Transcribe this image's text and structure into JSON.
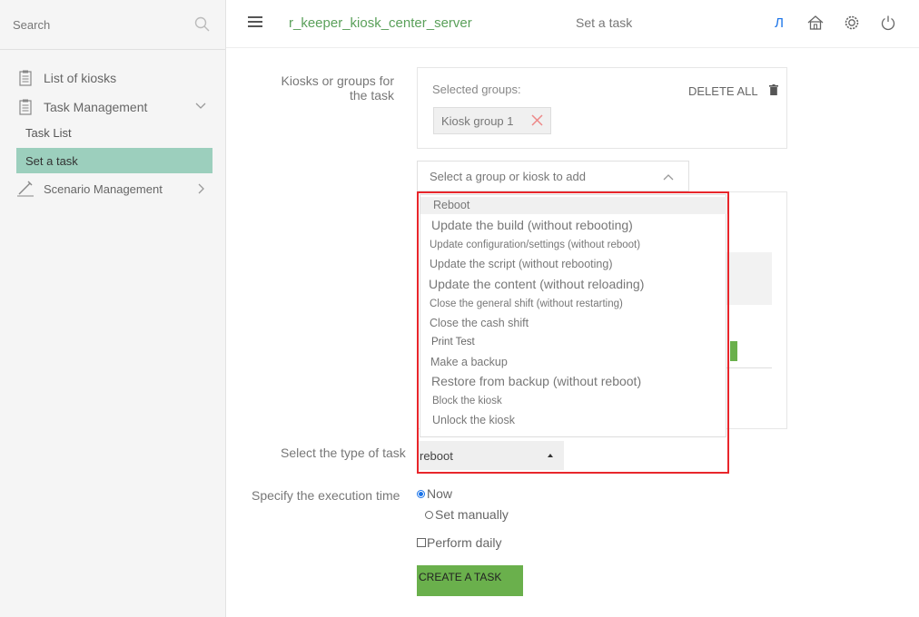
{
  "sidebar": {
    "search_placeholder": "Search",
    "items": [
      {
        "label": "List of kiosks"
      },
      {
        "label": "Task Management"
      },
      {
        "label": "Task List"
      },
      {
        "label": "Set a task"
      },
      {
        "label": "Scenario Management"
      }
    ]
  },
  "header": {
    "app_title": "r_keeper_kiosk_center_server",
    "page_title": "Set a task",
    "lang": "Л"
  },
  "form": {
    "kiosks_label": "Kiosks or groups for the task",
    "selected_groups_label": "Selected groups:",
    "delete_all_label": "DELETE ALL",
    "chips": [
      {
        "label": "Kiosk group 1"
      }
    ],
    "group_select_placeholder": "Select a group or kiosk to add",
    "task_type_label": "Select the type of task",
    "task_type_value": "reboot",
    "task_type_options": [
      "Reboot",
      "Update the build (without rebooting)",
      "Update configuration/settings (without reboot)",
      "Update the script (without rebooting)",
      "Update the content (without reloading)",
      "Close the general shift (without restarting)",
      "Close the cash shift",
      "Print Test",
      "Make a backup",
      "Restore from backup (without reboot)",
      "Block the kiosk",
      "Unlock the kiosk"
    ],
    "exec_time_label": "Specify the execution time",
    "radio_now": "Now",
    "radio_manual": "Set manually",
    "daily_label": "Perform daily",
    "create_label": "CREATE A TASK"
  },
  "colors": {
    "accent_green": "#6ab04c",
    "active_nav": "#9ccfbd",
    "highlight_frame": "#e8262b",
    "title_green": "#5aa05a"
  }
}
